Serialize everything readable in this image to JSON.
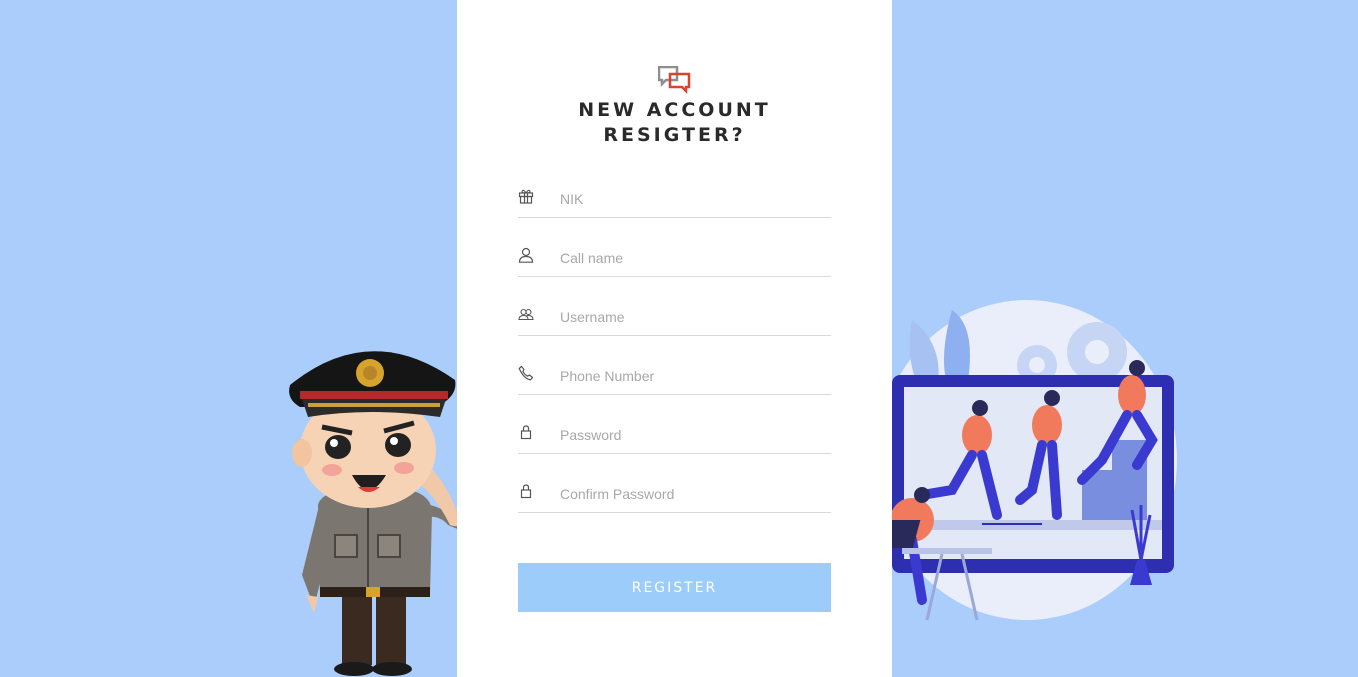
{
  "heading": {
    "line1": "NEW ACCOUNT",
    "line2": "RESIGTER?"
  },
  "fields": [
    {
      "placeholder": "NIK",
      "icon": "gift-icon"
    },
    {
      "placeholder": "Call name",
      "icon": "user-icon"
    },
    {
      "placeholder": "Username",
      "icon": "users-icon"
    },
    {
      "placeholder": "Phone Number",
      "icon": "phone-icon"
    },
    {
      "placeholder": "Password",
      "icon": "lock-icon"
    },
    {
      "placeholder": "Confirm Password",
      "icon": "lock-icon"
    }
  ],
  "register_label": "REGISTER",
  "colors": {
    "background": "#abcdfc",
    "button": "#9bccfa",
    "logo_accent": "#d9442b"
  }
}
